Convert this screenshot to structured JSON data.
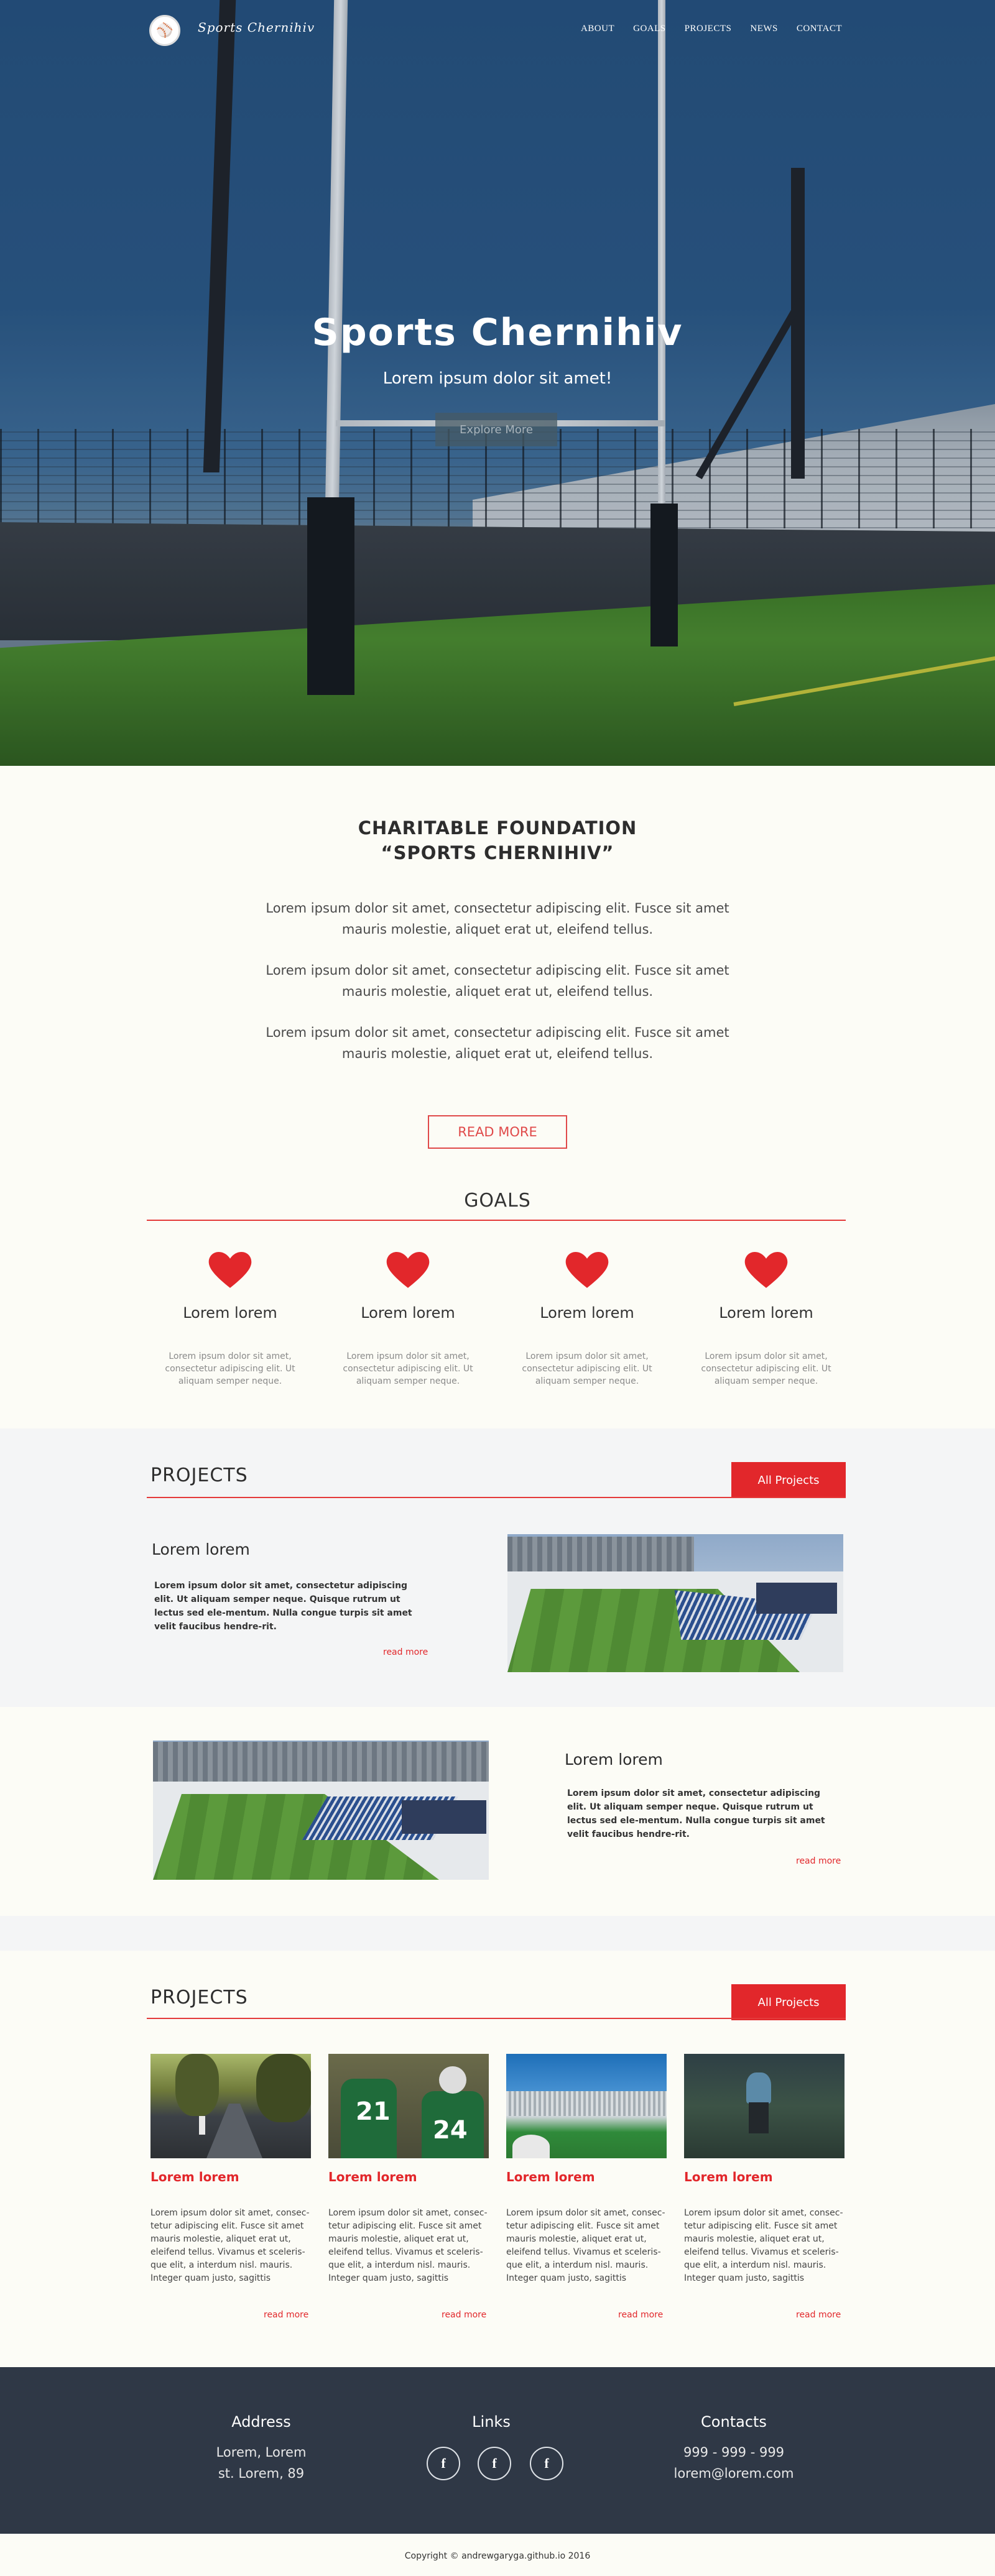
{
  "nav": {
    "brand": "Sports Chernihiv",
    "links": [
      "ABOUT",
      "GOALS",
      "PROJECTS",
      "NEWS",
      "CONTACT"
    ]
  },
  "hero": {
    "title": "Sports Chernihiv",
    "subtitle": "Lorem ipsum dolor sit amet!",
    "button": "Explore More"
  },
  "about": {
    "title": "CHARITABLE FOUNDATION “SPORTS CHERNIHIV”",
    "paragraphs": [
      "Lorem ipsum dolor sit amet, consectetur adipiscing elit. Fusce sit amet mauris molestie, aliquet erat ut, eleifend tellus.",
      "Lorem ipsum dolor sit amet, consectetur adipiscing elit. Fusce sit amet mauris molestie, aliquet erat ut, eleifend tellus.",
      "Lorem ipsum dolor sit amet, consectetur adipiscing elit. Fusce sit amet mauris molestie, aliquet erat ut, eleifend tellus."
    ],
    "button": "READ MORE"
  },
  "goals": {
    "title": "GOALS",
    "items": [
      {
        "icon": "heart-icon",
        "title": "Lorem lorem",
        "text": "Lorem ipsum dolor sit amet, consectetur adipiscing elit. Ut aliquam semper neque."
      },
      {
        "icon": "heart-icon",
        "title": "Lorem lorem",
        "text": "Lorem ipsum dolor sit amet, consectetur adipiscing elit. Ut aliquam semper neque."
      },
      {
        "icon": "heart-icon",
        "title": "Lorem lorem",
        "text": "Lorem ipsum dolor sit amet, consectetur adipiscing elit. Ut aliquam semper neque."
      },
      {
        "icon": "heart-icon",
        "title": "Lorem lorem",
        "text": "Lorem ipsum dolor sit amet, consectetur adipiscing elit. Ut aliquam semper neque."
      }
    ]
  },
  "projects_a": {
    "title": "PROJECTS",
    "all_button": "All Projects",
    "items": [
      {
        "title": "Lorem lorem",
        "text": "Lorem ipsum dolor sit amet, consectetur adipiscing elit. Ut aliquam semper neque. Quisque rutrum ut lectus sed ele-mentum. Nulla congue turpis sit amet velit faucibus hendre-rit.",
        "link": "read more"
      },
      {
        "title": "Lorem lorem",
        "text": "Lorem ipsum dolor sit amet, consectetur adipiscing elit. Ut aliquam semper neque. Quisque rutrum ut lectus sed ele-mentum. Nulla congue turpis sit amet velit faucibus hendre-rit.",
        "link": "read more"
      }
    ]
  },
  "projects_b": {
    "title": "PROJECTS",
    "all_button": "All Projects",
    "cards": [
      {
        "title": "Lorem lorem",
        "text": "Lorem ipsum dolor sit amet, consec-tetur adipiscing elit. Fusce sit amet mauris molestie, aliquet erat ut, eleifend tellus. Vivamus et sceleris-que elit, a interdum nisl. mauris. Integer quam justo, sagittis",
        "link": "read more"
      },
      {
        "title": "Lorem lorem",
        "text": "Lorem ipsum dolor sit amet, consec-tetur adipiscing elit. Fusce sit amet mauris molestie, aliquet erat ut, eleifend tellus. Vivamus et sceleris-que elit, a interdum nisl. mauris. Integer quam justo, sagittis",
        "link": "read more"
      },
      {
        "title": "Lorem lorem",
        "text": "Lorem ipsum dolor sit amet, consec-tetur adipiscing elit. Fusce sit amet mauris molestie, aliquet erat ut, eleifend tellus. Vivamus et sceleris-que elit, a interdum nisl. mauris. Integer quam justo, sagittis",
        "link": "read more"
      },
      {
        "title": "Lorem lorem",
        "text": "Lorem ipsum dolor sit amet, consec-tetur adipiscing elit. Fusce sit amet mauris molestie, aliquet erat ut, eleifend tellus. Vivamus et sceleris-que elit, a interdum nisl. mauris. Integer quam justo, sagittis",
        "link": "read more"
      }
    ]
  },
  "footer": {
    "address_title": "Address",
    "address_lines": [
      "Lorem, Lorem",
      "st. Lorem, 89"
    ],
    "links_title": "Links",
    "social": [
      "f",
      "f",
      "f"
    ],
    "contacts_title": "Contacts",
    "phone": "999 - 999 - 999",
    "email": "lorem@lorem.com"
  },
  "copyright": "Copyright © andrewgaryga.github.io 2016",
  "colors": {
    "accent": "#e2272b",
    "footer_bg": "#2f3846",
    "page_bg": "#fcfcf6"
  }
}
